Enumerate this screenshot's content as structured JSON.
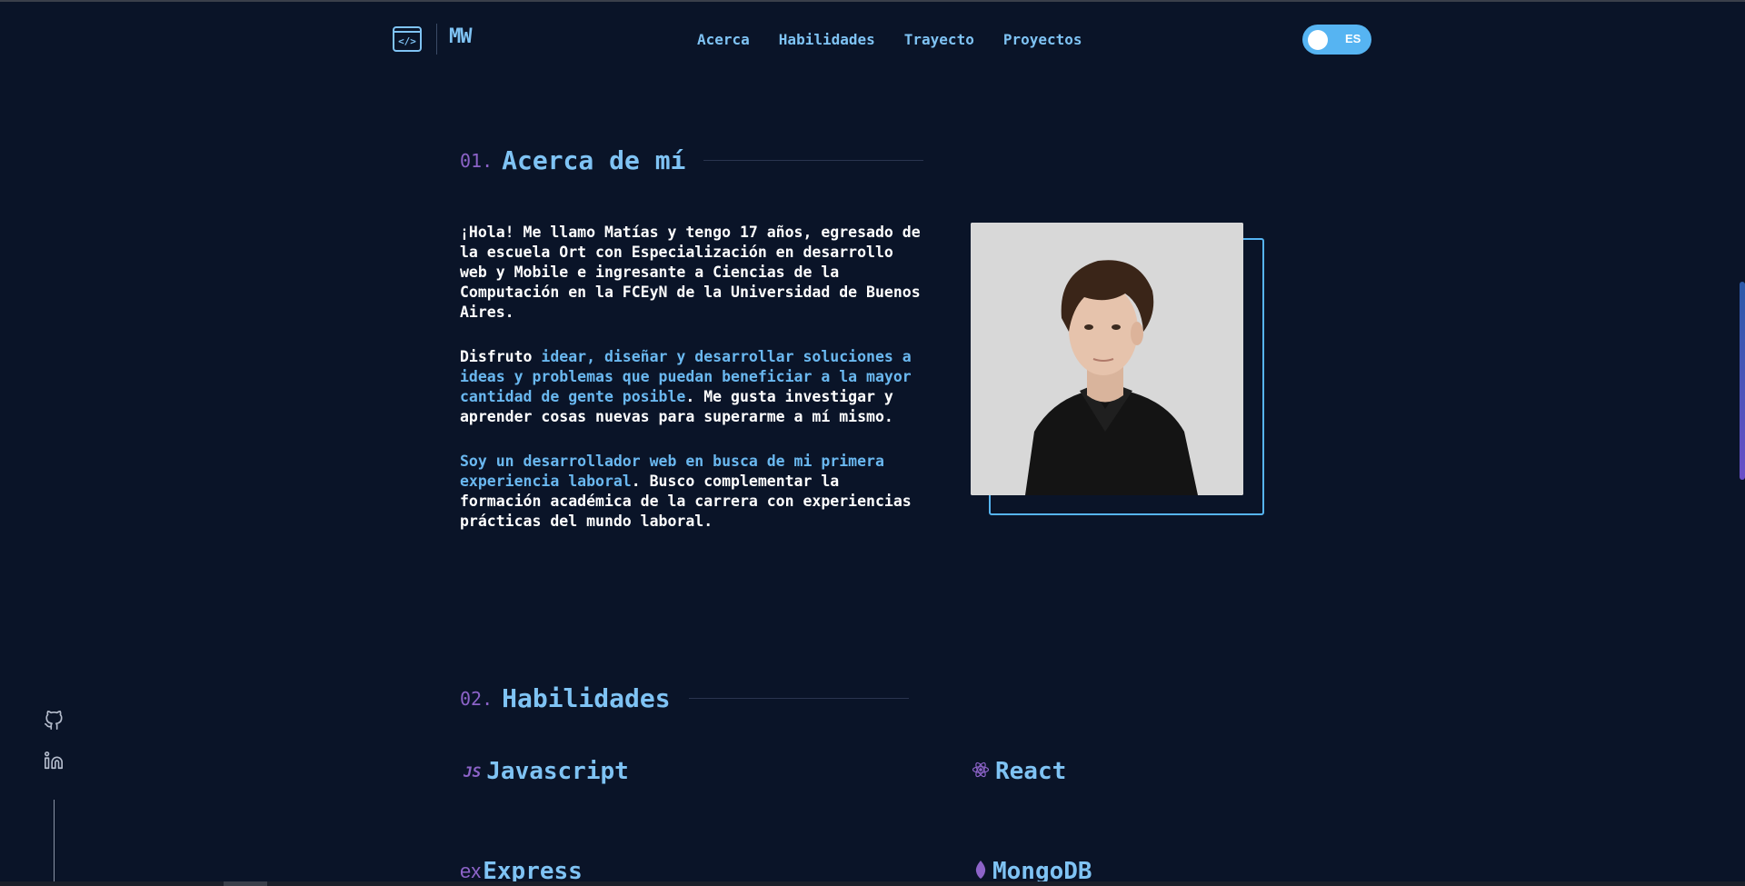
{
  "header": {
    "logo_icon": "</>",
    "logo_text": "MW",
    "nav": [
      "Acerca",
      "Habilidades",
      "Trayecto",
      "Proyectos"
    ],
    "lang": "ES"
  },
  "about": {
    "number": "01.",
    "title": "Acerca de mí",
    "p1": "¡Hola! Me llamo Matías y tengo 17 años, egresado de la escuela Ort con Especialización en desarrollo web y Mobile e ingresante a Ciencias de la Computación en la FCEyN de la Universidad de Buenos Aires.",
    "p2_start": "Disfruto ",
    "p2_highlight": "idear, diseñar y desarrollar soluciones a ideas y problemas que puedan beneficiar a la mayor cantidad de gente posible",
    "p2_end": ". Me gusta investigar y aprender cosas nuevas para superarme a mí mismo.",
    "p3_highlight": "Soy un desarrollador web en busca de mi primera experiencia laboral",
    "p3_end": ". Busco complementar la formación académica de la carrera con experiencias prácticas del mundo laboral."
  },
  "skills": {
    "number": "02.",
    "title": "Habilidades",
    "items": [
      {
        "icon": "JS",
        "name": "Javascript"
      },
      {
        "icon": "react-icon",
        "name": "React"
      },
      {
        "icon": "ex",
        "name": "Express"
      },
      {
        "icon": "mongodb-leaf-icon",
        "name": "MongoDB"
      }
    ]
  },
  "colors": {
    "background": "#0a1428",
    "accent": "#7fc3f4",
    "number": "#8c63c8"
  }
}
